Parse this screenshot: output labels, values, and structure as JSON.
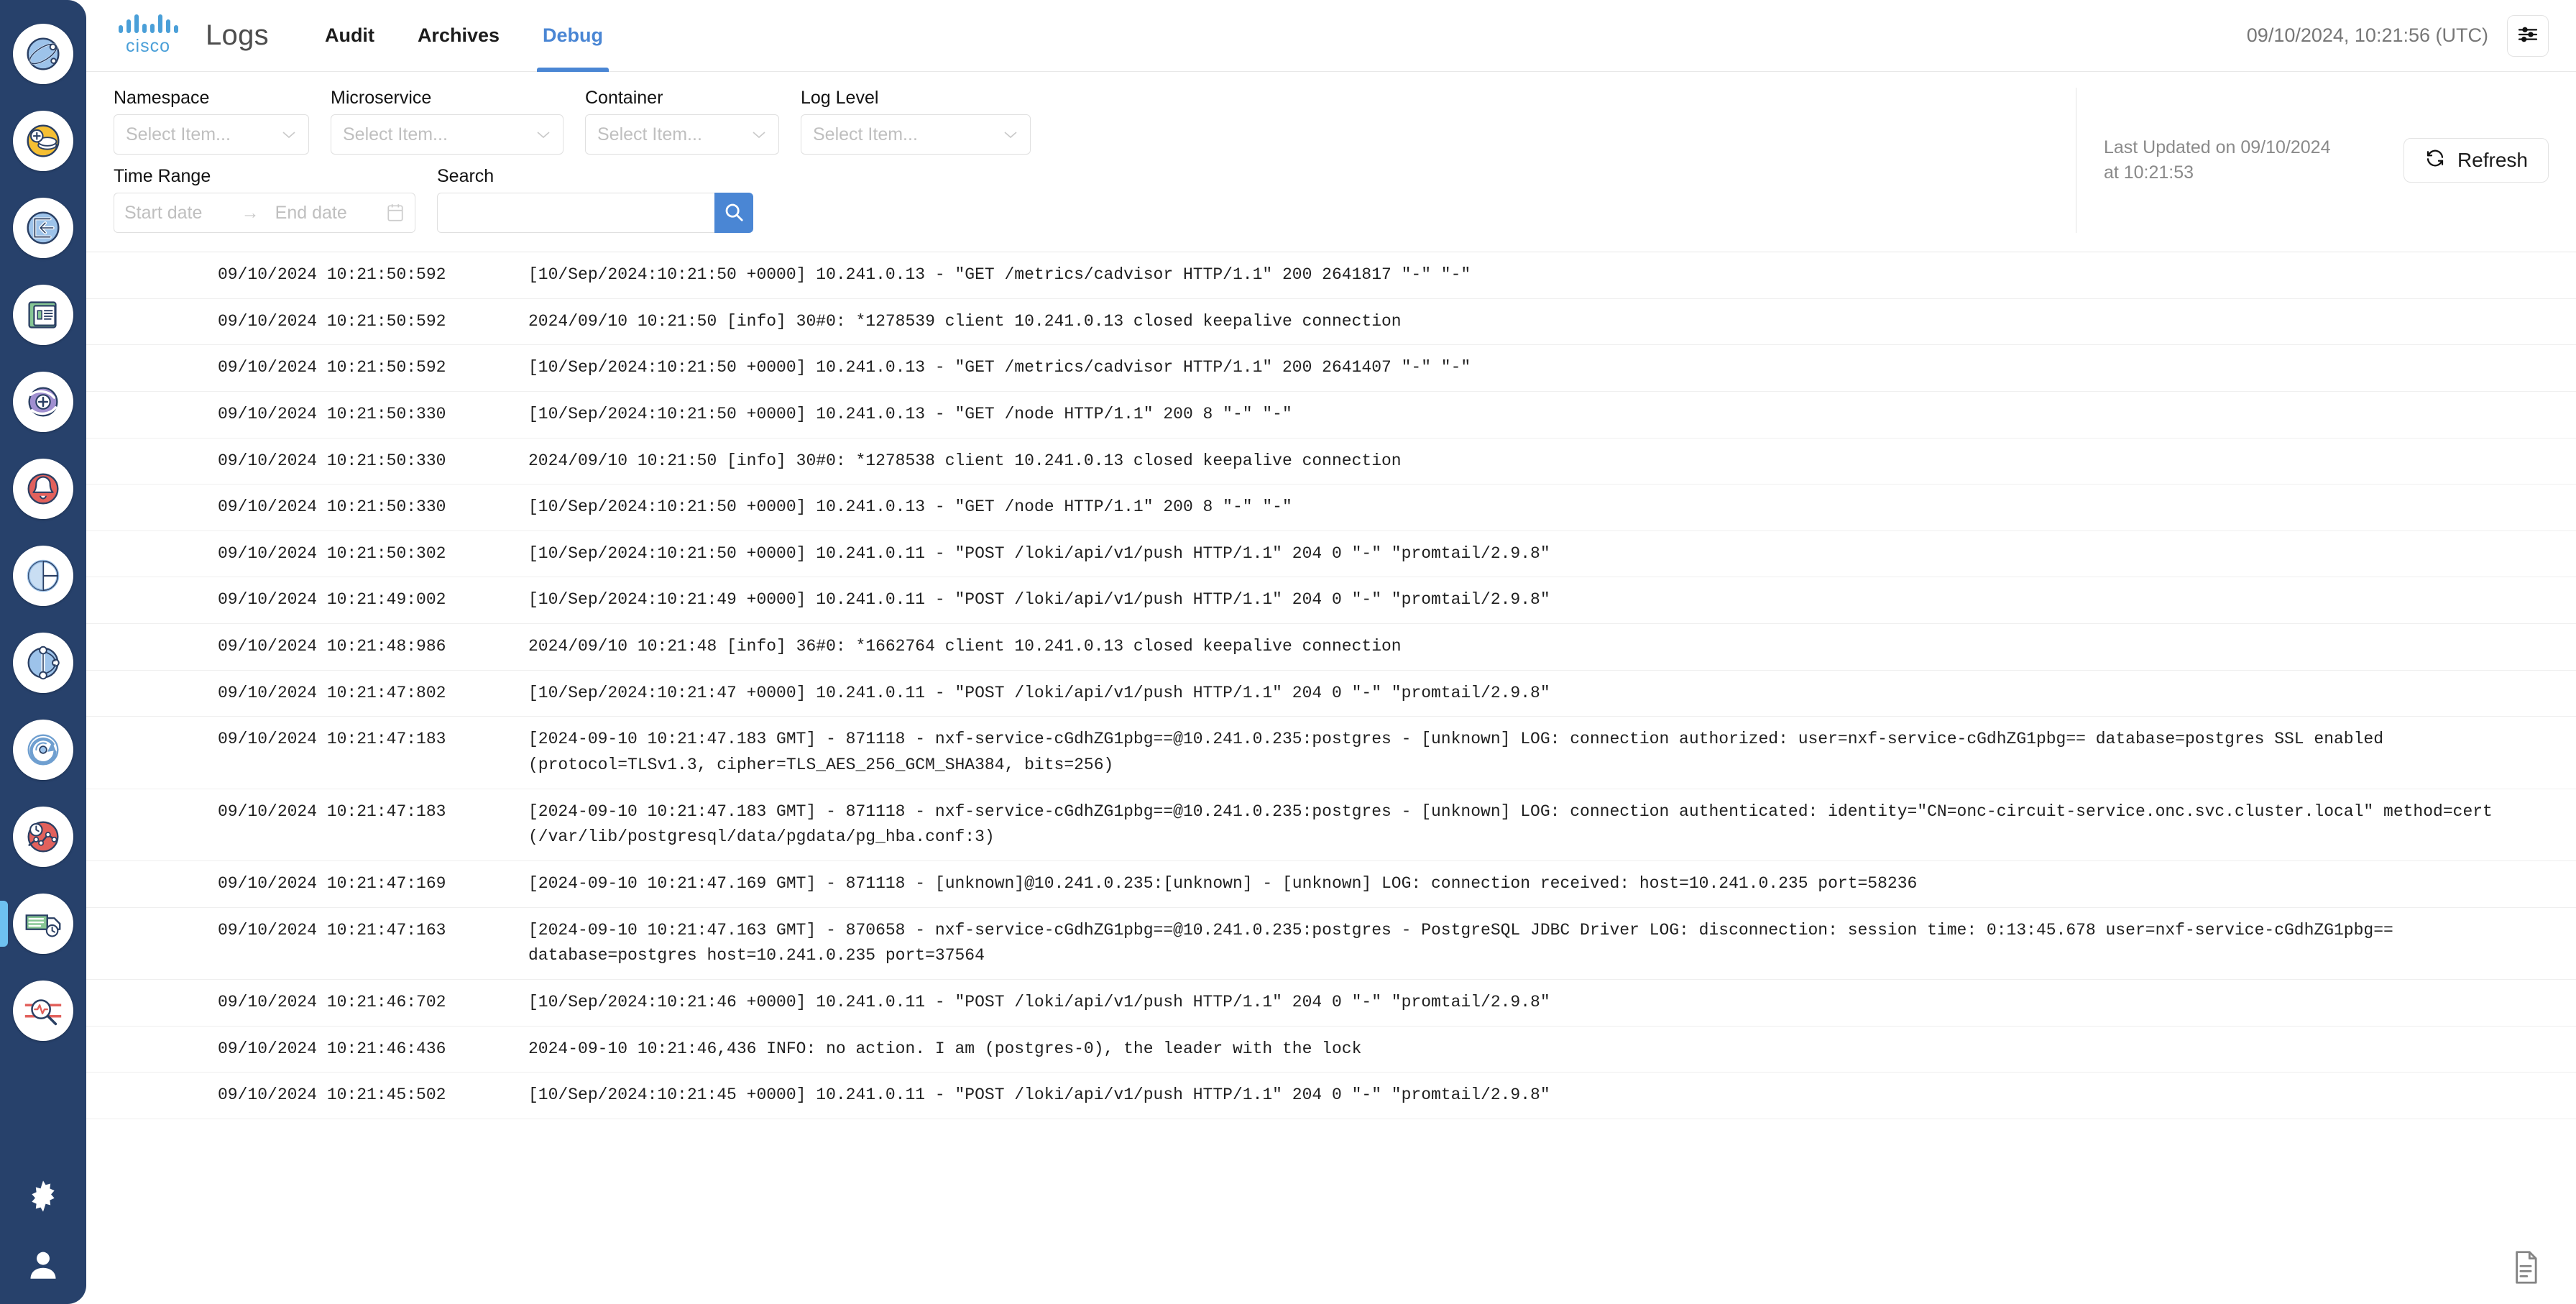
{
  "sidebar": {
    "items": [
      {
        "name": "dashboard-globe",
        "icon": "globe-icon"
      },
      {
        "name": "add-coins",
        "icon": "coins-plus-icon"
      },
      {
        "name": "login-arrow",
        "icon": "login-arrow-icon"
      },
      {
        "name": "inventory-document",
        "icon": "document-list-icon"
      },
      {
        "name": "add-orbit",
        "icon": "orbit-plus-icon"
      },
      {
        "name": "alarms-bell",
        "icon": "bell-icon"
      },
      {
        "name": "split-circle",
        "icon": "split-circle-icon"
      },
      {
        "name": "topology-nodes",
        "icon": "topology-icon"
      },
      {
        "name": "sync-refresh",
        "icon": "sync-circle-icon"
      },
      {
        "name": "performance-chart",
        "icon": "chart-clock-icon"
      },
      {
        "name": "logs-truck",
        "icon": "logs-icon",
        "active": true
      },
      {
        "name": "diagnostics-search",
        "icon": "pulse-search-icon"
      }
    ],
    "bottom": [
      {
        "name": "settings",
        "icon": "gear-icon"
      },
      {
        "name": "account",
        "icon": "user-icon"
      }
    ]
  },
  "header": {
    "brand": "cisco",
    "title": "Logs",
    "tabs": [
      {
        "label": "Audit",
        "active": false
      },
      {
        "label": "Archives",
        "active": false
      },
      {
        "label": "Debug",
        "active": true
      }
    ],
    "clock": "09/10/2024, 10:21:56 (UTC)",
    "settings_icon": "sliders-icon",
    "accent_color": "#4a86d4",
    "brand_color": "#4a9fd8"
  },
  "filters": {
    "namespace": {
      "label": "Namespace",
      "placeholder": "Select Item...",
      "value": ""
    },
    "microservice": {
      "label": "Microservice",
      "placeholder": "Select Item...",
      "value": ""
    },
    "container": {
      "label": "Container",
      "placeholder": "Select Item...",
      "value": ""
    },
    "log_level": {
      "label": "Log Level",
      "placeholder": "Select Item...",
      "value": ""
    },
    "time_range": {
      "label": "Time Range",
      "start_placeholder": "Start date",
      "end_placeholder": "End date",
      "separator": "→"
    },
    "search": {
      "label": "Search",
      "placeholder": "",
      "value": "",
      "button_icon": "search-icon"
    },
    "last_updated_line1": "Last Updated on 09/10/2024",
    "last_updated_line2": "at 10:21:53",
    "refresh_label": "Refresh",
    "refresh_icon": "refresh-icon"
  },
  "logs": {
    "export_icon": "export-document-icon",
    "rows": [
      {
        "ts": "09/10/2024 10:21:50:592",
        "msg": "[10/Sep/2024:10:21:50 +0000] 10.241.0.13 - \"GET /metrics/cadvisor HTTP/1.1\" 200 2641817 \"-\" \"-\""
      },
      {
        "ts": "09/10/2024 10:21:50:592",
        "msg": "2024/09/10 10:21:50 [info] 30#0: *1278539 client 10.241.0.13 closed keepalive connection"
      },
      {
        "ts": "09/10/2024 10:21:50:592",
        "msg": "[10/Sep/2024:10:21:50 +0000] 10.241.0.13 - \"GET /metrics/cadvisor HTTP/1.1\" 200 2641407 \"-\" \"-\""
      },
      {
        "ts": "09/10/2024 10:21:50:330",
        "msg": "[10/Sep/2024:10:21:50 +0000] 10.241.0.13 - \"GET /node HTTP/1.1\" 200 8 \"-\" \"-\""
      },
      {
        "ts": "09/10/2024 10:21:50:330",
        "msg": "2024/09/10 10:21:50 [info] 30#0: *1278538 client 10.241.0.13 closed keepalive connection"
      },
      {
        "ts": "09/10/2024 10:21:50:330",
        "msg": "[10/Sep/2024:10:21:50 +0000] 10.241.0.13 - \"GET /node HTTP/1.1\" 200 8 \"-\" \"-\""
      },
      {
        "ts": "09/10/2024 10:21:50:302",
        "msg": "[10/Sep/2024:10:21:50 +0000] 10.241.0.11 - \"POST /loki/api/v1/push HTTP/1.1\" 204 0 \"-\" \"promtail/2.9.8\""
      },
      {
        "ts": "09/10/2024 10:21:49:002",
        "msg": "[10/Sep/2024:10:21:49 +0000] 10.241.0.11 - \"POST /loki/api/v1/push HTTP/1.1\" 204 0 \"-\" \"promtail/2.9.8\""
      },
      {
        "ts": "09/10/2024 10:21:48:986",
        "msg": "2024/09/10 10:21:48 [info] 36#0: *1662764 client 10.241.0.13 closed keepalive connection"
      },
      {
        "ts": "09/10/2024 10:21:47:802",
        "msg": "[10/Sep/2024:10:21:47 +0000] 10.241.0.11 - \"POST /loki/api/v1/push HTTP/1.1\" 204 0 \"-\" \"promtail/2.9.8\""
      },
      {
        "ts": "09/10/2024 10:21:47:183",
        "msg": "[2024-09-10 10:21:47.183 GMT] - 871118 - nxf-service-cGdhZG1pbg==@10.241.0.235:postgres - [unknown] LOG:  connection authorized: user=nxf-service-cGdhZG1pbg== database=postgres SSL enabled (protocol=TLSv1.3, cipher=TLS_AES_256_GCM_SHA384, bits=256)"
      },
      {
        "ts": "09/10/2024 10:21:47:183",
        "msg": "[2024-09-10 10:21:47.183 GMT] - 871118 - nxf-service-cGdhZG1pbg==@10.241.0.235:postgres - [unknown] LOG:  connection authenticated: identity=\"CN=onc-circuit-service.onc.svc.cluster.local\" method=cert (/var/lib/postgresql/data/pgdata/pg_hba.conf:3)"
      },
      {
        "ts": "09/10/2024 10:21:47:169",
        "msg": "[2024-09-10 10:21:47.169 GMT] - 871118 - [unknown]@10.241.0.235:[unknown] - [unknown] LOG:  connection received: host=10.241.0.235 port=58236"
      },
      {
        "ts": "09/10/2024 10:21:47:163",
        "msg": "[2024-09-10 10:21:47.163 GMT] - 870658 - nxf-service-cGdhZG1pbg==@10.241.0.235:postgres - PostgreSQL JDBC Driver LOG:  disconnection: session time: 0:13:45.678 user=nxf-service-cGdhZG1pbg== database=postgres host=10.241.0.235 port=37564"
      },
      {
        "ts": "09/10/2024 10:21:46:702",
        "msg": "[10/Sep/2024:10:21:46 +0000] 10.241.0.11 - \"POST /loki/api/v1/push HTTP/1.1\" 204 0 \"-\" \"promtail/2.9.8\""
      },
      {
        "ts": "09/10/2024 10:21:46:436",
        "msg": "2024-09-10 10:21:46,436 INFO: no action. I am (postgres-0), the leader with the lock"
      },
      {
        "ts": "09/10/2024 10:21:45:502",
        "msg": "[10/Sep/2024:10:21:45 +0000] 10.241.0.11 - \"POST /loki/api/v1/push HTTP/1.1\" 204 0 \"-\" \"promtail/2.9.8\""
      }
    ]
  }
}
